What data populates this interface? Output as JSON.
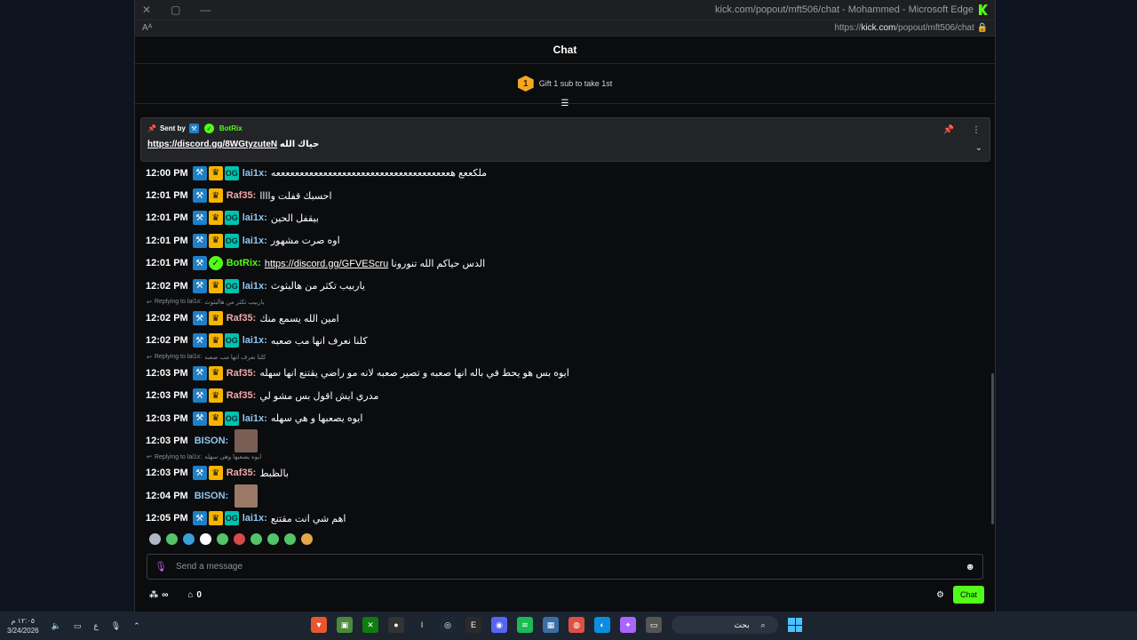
{
  "browser": {
    "window_title": "kick.com/popout/mft506/chat - Mohammed - Microsoft Edge",
    "url_prefix": "https://",
    "url_domain": "kick.com",
    "url_path": "/popout/mft506/chat",
    "reader_icon": "Aᴬ"
  },
  "chat": {
    "header": "Chat",
    "gift": {
      "rank": "1",
      "text": "Gift 1 sub to take 1st"
    },
    "pinned": {
      "sent_by": "Sent by",
      "bot_name": "BotRix",
      "message_prefix": "https://discord.gg/8WGtyzuteN",
      "message_suffix": "حياك الله"
    },
    "messages": [
      {
        "time": "12:00 PM",
        "badges": [
          "mod",
          "vip",
          "og"
        ],
        "user": "lai1x",
        "color": "#8fc7f0",
        "text": "ملكععع هعععععععععععععععععععععععععععععععععععععه"
      },
      {
        "time": "12:01 PM",
        "badges": [
          "mod",
          "vip"
        ],
        "user": "Raf35",
        "color": "#f4a7a7",
        "text": "احسبك قفلت واااا"
      },
      {
        "time": "12:01 PM",
        "badges": [
          "mod",
          "vip",
          "og"
        ],
        "user": "lai1x",
        "color": "#8fc7f0",
        "text": "بيقفل الحين"
      },
      {
        "time": "12:01 PM",
        "badges": [
          "mod",
          "vip",
          "og"
        ],
        "user": "lai1x",
        "color": "#8fc7f0",
        "text": "اوه صرت مشهور"
      },
      {
        "time": "12:01 PM",
        "badges": [
          "mod",
          "verified"
        ],
        "user": "BotRix",
        "color": "#53fc18",
        "link": "https://discord.gg/GFVEScru",
        "text": "الدس حياكم الله تنورونا"
      },
      {
        "time": "12:02 PM",
        "badges": [
          "mod",
          "vip",
          "og"
        ],
        "user": "lai1x",
        "color": "#8fc7f0",
        "text": "ياربيب تكثر من هالبثوث"
      },
      {
        "reply_to": "Replying to lai1x:",
        "reply_text": "ياربيب تكثر من هالبثوث",
        "time": "12:02 PM",
        "badges": [
          "mod",
          "vip"
        ],
        "user": "Raf35",
        "color": "#f4a7a7",
        "text": "امين الله يسمع منك"
      },
      {
        "time": "12:02 PM",
        "badges": [
          "mod",
          "vip",
          "og"
        ],
        "user": "lai1x",
        "color": "#8fc7f0",
        "text": "كلنا نعرف انها مب صعبه"
      },
      {
        "reply_to": "Replying to lai1x:",
        "reply_text": "كلنا نعرف انها مب صعبه",
        "time": "12:03 PM",
        "badges": [
          "mod",
          "vip"
        ],
        "user": "Raf35",
        "color": "#f4a7a7",
        "text": "ايوه بس هو يحط في باله انها صعبه و تصير صعبه لانه مو راضي يقتنع انها سهله"
      },
      {
        "time": "12:03 PM",
        "badges": [
          "mod",
          "vip"
        ],
        "user": "Raf35",
        "color": "#f4a7a7",
        "text": "مدري ايش اقول بس مشو لي"
      },
      {
        "time": "12:03 PM",
        "badges": [
          "mod",
          "vip",
          "og"
        ],
        "user": "lai1x",
        "color": "#8fc7f0",
        "text": "ايوه يصعبها و هي سهله"
      },
      {
        "time": "12:03 PM",
        "badges": [],
        "user": "BISON",
        "color": "#8fc7f0",
        "text": "",
        "emote": "#7a5e55"
      },
      {
        "reply_to": "Replying to lai1x:",
        "reply_text": "ايوه يصعبها وهي سهله",
        "time": "12:03 PM",
        "badges": [
          "mod",
          "vip"
        ],
        "user": "Raf35",
        "color": "#f4a7a7",
        "text": "بالظبط"
      },
      {
        "time": "12:04 PM",
        "badges": [],
        "user": "BISON",
        "color": "#8fc7f0",
        "text": "",
        "emote": "#9a7a66"
      },
      {
        "time": "12:05 PM",
        "badges": [
          "mod",
          "vip",
          "og"
        ],
        "user": "lai1x",
        "color": "#8fc7f0",
        "text": "اهم شي انت مقتنع"
      }
    ],
    "emote_bar_colors": [
      "#b0b8c4",
      "#53c46a",
      "#3aa0d6",
      "#ffffff",
      "#53c46a",
      "#d94a4a",
      "#53c46a",
      "#53c46a",
      "#53c46a",
      "#e3a84a"
    ],
    "composer_placeholder": "Send a message",
    "points_value": "∞",
    "points_count": "0",
    "chat_button": "Chat"
  },
  "taskbar": {
    "time": "١٢:٠٥ م",
    "date": "3/24/2026",
    "lang": "ع",
    "search_label": "بحث"
  }
}
